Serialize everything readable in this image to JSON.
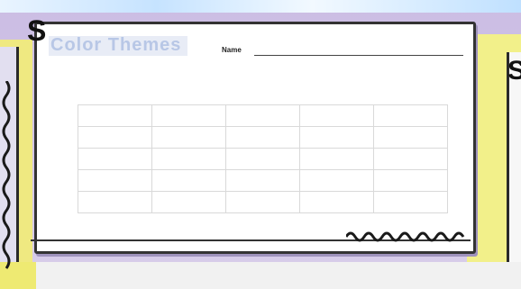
{
  "page": {
    "title": "Color Themes",
    "subtitle": "",
    "name_label": "Name",
    "instructions": ""
  },
  "grid": {
    "rows": [
      [
        "",
        "",
        "",
        "",
        ""
      ],
      [
        "",
        "",
        "",
        "",
        ""
      ],
      [
        "",
        "",
        "",
        "",
        ""
      ],
      [
        "",
        "",
        "",
        "",
        ""
      ],
      [
        "",
        "",
        "",
        "",
        ""
      ]
    ]
  },
  "colors": {
    "frame": "#333333",
    "title": "#b8c7e6",
    "left_panel": "#efe981",
    "right_panel": "#f2f08a",
    "background": "#cbbde3"
  },
  "icons": {
    "decor_letter": "S"
  }
}
